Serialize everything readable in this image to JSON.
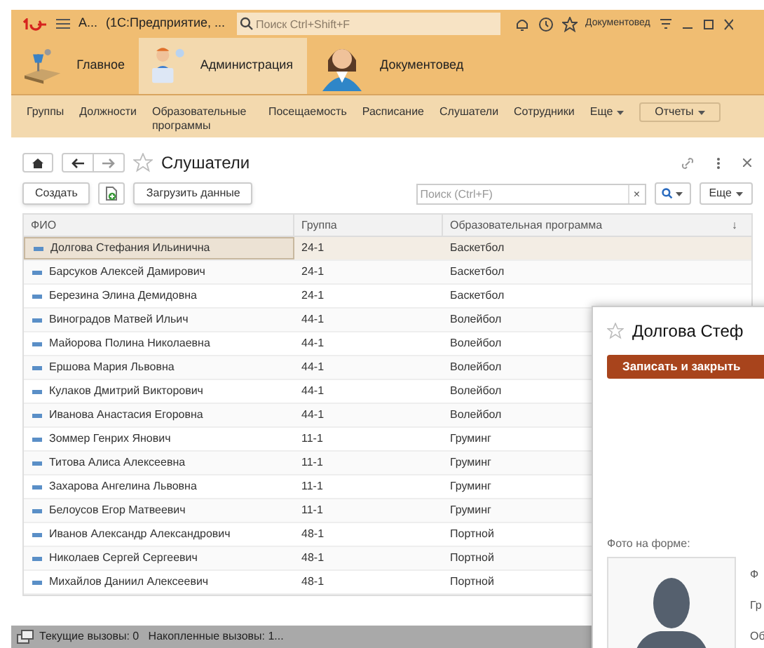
{
  "titlebar": {
    "app_short": "А...",
    "app_title": "(1С:Предприятие, ...",
    "search_placeholder": "Поиск Ctrl+Shift+F",
    "user": "Документовед"
  },
  "sections": [
    {
      "label": "Главное",
      "selected": false,
      "kind": "desk"
    },
    {
      "label": "Администрация",
      "selected": true,
      "kind": "admin"
    },
    {
      "label": "Документовед",
      "selected": false,
      "kind": "operator"
    }
  ],
  "nav": [
    {
      "label": "Группы",
      "kind": "link"
    },
    {
      "label": "Должности",
      "kind": "link"
    },
    {
      "label": "Образовательные программы",
      "kind": "link"
    },
    {
      "label": "Посещаемость",
      "kind": "link"
    },
    {
      "label": "Расписание",
      "kind": "link"
    },
    {
      "label": "Слушатели",
      "kind": "link"
    },
    {
      "label": "Сотрудники",
      "kind": "link"
    },
    {
      "label": "Еще",
      "kind": "menu"
    },
    {
      "label": "Отчеты",
      "kind": "button"
    }
  ],
  "form": {
    "title": "Слушатели",
    "create": "Создать",
    "load": "Загрузить данные",
    "search_placeholder": "Поиск (Ctrl+F)",
    "clear": "×",
    "more": "Еще"
  },
  "table": {
    "columns": [
      "ФИО",
      "Группа",
      "Образовательная программа"
    ],
    "sort_mark": "↓",
    "rows": [
      {
        "cells": [
          "Долгова Стефания Ильинична",
          "24-1",
          "Баскетбол"
        ],
        "selected": true
      },
      {
        "cells": [
          "Барсуков Алексей Дамирович",
          "24-1",
          "Баскетбол"
        ],
        "selected": false
      },
      {
        "cells": [
          "Березина Элина Демидовна",
          "24-1",
          "Баскетбол"
        ],
        "selected": false
      },
      {
        "cells": [
          "Виноградов Матвей Ильич",
          "44-1",
          "Волейбол"
        ],
        "selected": false
      },
      {
        "cells": [
          "Майорова Полина Николаевна",
          "44-1",
          "Волейбол"
        ],
        "selected": false
      },
      {
        "cells": [
          "Ершова Мария Львовна",
          "44-1",
          "Волейбол"
        ],
        "selected": false
      },
      {
        "cells": [
          "Кулаков Дмитрий Викторович",
          "44-1",
          "Волейбол"
        ],
        "selected": false
      },
      {
        "cells": [
          "Иванова Анастасия Егоровна",
          "44-1",
          "Волейбол"
        ],
        "selected": false
      },
      {
        "cells": [
          "Зоммер Генрих Янович",
          "11-1",
          "Груминг"
        ],
        "selected": false
      },
      {
        "cells": [
          "Титова Алиса Алексеевна",
          "11-1",
          "Груминг"
        ],
        "selected": false
      },
      {
        "cells": [
          "Захарова Ангелина Львовна",
          "11-1",
          "Груминг"
        ],
        "selected": false
      },
      {
        "cells": [
          "Белоусов Егор Матвеевич",
          "11-1",
          "Груминг"
        ],
        "selected": false
      },
      {
        "cells": [
          "Иванов Александр Александрович",
          "48-1",
          "Портной"
        ],
        "selected": false
      },
      {
        "cells": [
          "Николаев Сергей Сергеевич",
          "48-1",
          "Портной"
        ],
        "selected": false
      },
      {
        "cells": [
          "Михайлов Даниил Алексеевич",
          "48-1",
          "Портной"
        ],
        "selected": false
      }
    ]
  },
  "status_bar": {
    "text": "Текущие вызовы: 0   Накопленные вызовы: 1..."
  },
  "popup": {
    "title": "Долгова Стеф",
    "save": "Записать и закрыть",
    "photo_label": "Фото на форме:",
    "field_labels": [
      "Ф",
      "Гр",
      "Об"
    ]
  }
}
